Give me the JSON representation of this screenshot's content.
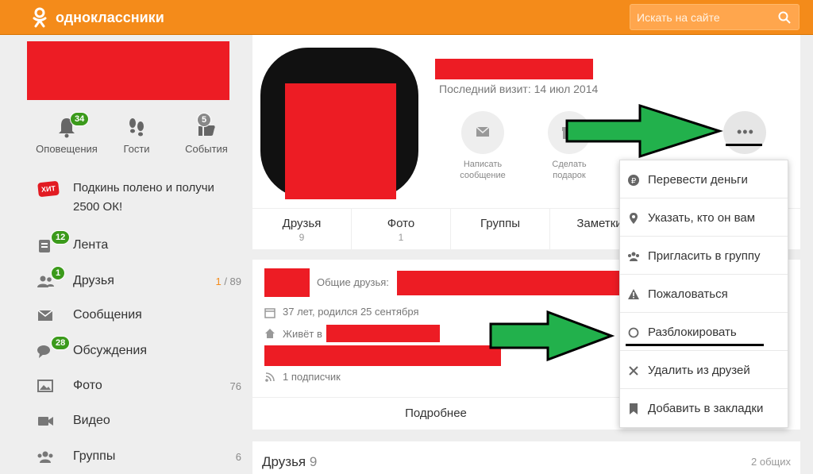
{
  "header": {
    "brand": "одноклассники",
    "search_placeholder": "Искать на сайте",
    "bg_color": "#f48b1a"
  },
  "sidebar": {
    "quick": [
      {
        "label": "Оповещения",
        "badge": "34",
        "icon": "bell-icon"
      },
      {
        "label": "Гости",
        "badge": "",
        "icon": "footprints-icon"
      },
      {
        "label": "События",
        "badge": "5",
        "icon": "thumbs-up-icon"
      }
    ],
    "promo": {
      "badge": "ХИТ",
      "text": "Подкинь полено и получи 2500 ОК!"
    },
    "items": [
      {
        "label": "Лента",
        "badge": "12",
        "count_hi": "",
        "count": "",
        "icon": "feed-icon"
      },
      {
        "label": "Друзья",
        "badge": "1",
        "count_hi": "1",
        "count": " / 89",
        "icon": "friends-icon"
      },
      {
        "label": "Сообщения",
        "badge": "",
        "count_hi": "",
        "count": "",
        "icon": "envelope-icon"
      },
      {
        "label": "Обсуждения",
        "badge": "28",
        "count_hi": "",
        "count": "",
        "icon": "chat-icon"
      },
      {
        "label": "Фото",
        "badge": "",
        "count_hi": "",
        "count": "76",
        "icon": "photo-icon"
      },
      {
        "label": "Видео",
        "badge": "",
        "count_hi": "",
        "count": "",
        "icon": "video-icon"
      },
      {
        "label": "Группы",
        "badge": "",
        "count_hi": "",
        "count": "6",
        "icon": "groups-icon"
      }
    ]
  },
  "profile": {
    "last_visit": "Последний визит: 14 июл 2014",
    "actions": [
      {
        "line1": "Написать",
        "line2": "сообщение",
        "icon": "envelope-icon"
      },
      {
        "line1": "Сделать",
        "line2": "подарок",
        "icon": "gift-icon"
      }
    ],
    "more_label": "•••",
    "tabs": [
      {
        "name": "Друзья",
        "count": "9"
      },
      {
        "name": "Фото",
        "count": "1"
      },
      {
        "name": "Группы",
        "count": ""
      },
      {
        "name": "Заметки",
        "count": ""
      }
    ]
  },
  "about": {
    "mutual_label": "Общие друзья:",
    "age": "37 лет, родился 25 сентября",
    "lives": "Живёт в",
    "subscribers": "1 подписчик",
    "more_link": "Подробнее"
  },
  "friends_section": {
    "title": "Друзья",
    "count": "9",
    "common": "2 общих"
  },
  "dropdown": {
    "items": [
      {
        "label": "Перевести деньги",
        "icon": "ruble-coin-icon"
      },
      {
        "label": "Указать, кто он вам",
        "icon": "location-pin-icon"
      },
      {
        "label": "Пригласить в группу",
        "icon": "group-invite-icon"
      },
      {
        "label": "Пожаловаться",
        "icon": "warning-icon"
      },
      {
        "label": "Разблокировать",
        "icon": "circle-icon"
      },
      {
        "label": "Удалить из друзей",
        "icon": "x-icon"
      },
      {
        "label": "Добавить в закладки",
        "icon": "bookmark-icon"
      }
    ]
  },
  "colors": {
    "accent": "#f48b1a",
    "badge_green": "#3b9a1b",
    "redaction": "#ed1c24",
    "arrow_green": "#22b14c"
  }
}
